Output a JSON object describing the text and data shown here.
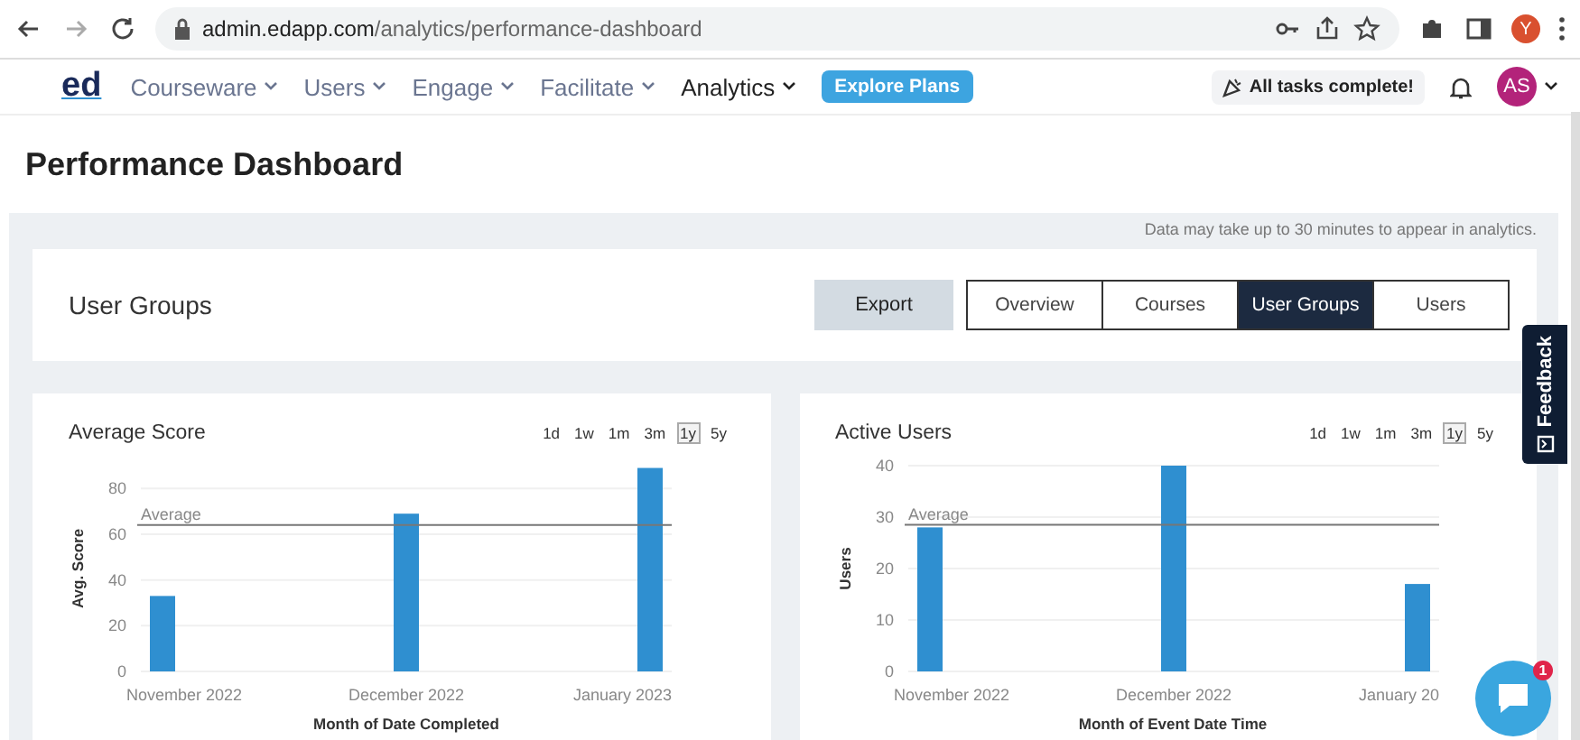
{
  "browser": {
    "url_host": "admin.edapp.com",
    "url_path": "/analytics/performance-dashboard",
    "profile_initial": "Y"
  },
  "nav": {
    "logo": "ed",
    "menu": [
      {
        "label": "Courseware",
        "selected": false
      },
      {
        "label": "Users",
        "selected": false
      },
      {
        "label": "Engage",
        "selected": false
      },
      {
        "label": "Facilitate",
        "selected": false
      },
      {
        "label": "Analytics",
        "selected": true
      }
    ],
    "explore_button": "Explore Plans",
    "tasks_badge": "All tasks complete!",
    "avatar": "AS"
  },
  "page_title": "Performance Dashboard",
  "notice": "Data may take up to 30 minutes to appear in analytics.",
  "section": {
    "title": "User Groups",
    "export_button": "Export",
    "tabs": [
      {
        "label": "Overview",
        "selected": false
      },
      {
        "label": "Courses",
        "selected": false
      },
      {
        "label": "User Groups",
        "selected": true
      },
      {
        "label": "Users",
        "selected": false
      }
    ]
  },
  "charts": [
    {
      "ranges": [
        {
          "label": "1d",
          "selected": false
        },
        {
          "label": "1w",
          "selected": false
        },
        {
          "label": "1m",
          "selected": false
        },
        {
          "label": "3m",
          "selected": false
        },
        {
          "label": "1y",
          "selected": true
        },
        {
          "label": "5y",
          "selected": false
        }
      ],
      "chart_data": {
        "type": "bar",
        "title": "Average Score",
        "xlabel": "Month of Date Completed",
        "ylabel": "Avg. Score",
        "categories": [
          "November 2022",
          "December 2022",
          "January 2023"
        ],
        "series": [
          {
            "color": "#2f8fd0",
            "values": [
              33,
              69,
              89
            ]
          }
        ],
        "ylim": [
          0,
          90
        ],
        "yticks": [
          0,
          20,
          40,
          60,
          80
        ],
        "grid": true,
        "ref_lines": [
          {
            "axis": "y",
            "value": 64,
            "label": "Average"
          }
        ]
      }
    },
    {
      "ranges": [
        {
          "label": "1d",
          "selected": false
        },
        {
          "label": "1w",
          "selected": false
        },
        {
          "label": "1m",
          "selected": false
        },
        {
          "label": "3m",
          "selected": false
        },
        {
          "label": "1y",
          "selected": true
        },
        {
          "label": "5y",
          "selected": false
        }
      ],
      "chart_data": {
        "type": "bar",
        "title": "Active Users",
        "xlabel": "Month of Event Date Time",
        "ylabel": "Users",
        "categories": [
          "November 2022",
          "December 2022",
          "January 20"
        ],
        "series": [
          {
            "color": "#2f8fd0",
            "values": [
              28,
              40,
              17
            ]
          }
        ],
        "ylim": [
          0,
          40
        ],
        "yticks": [
          0,
          10,
          20,
          30,
          40
        ],
        "grid": true,
        "ref_lines": [
          {
            "axis": "y",
            "value": 28.5,
            "label": "Average"
          }
        ]
      }
    }
  ],
  "feedback": "Feedback",
  "chat": {
    "badge": "1"
  }
}
